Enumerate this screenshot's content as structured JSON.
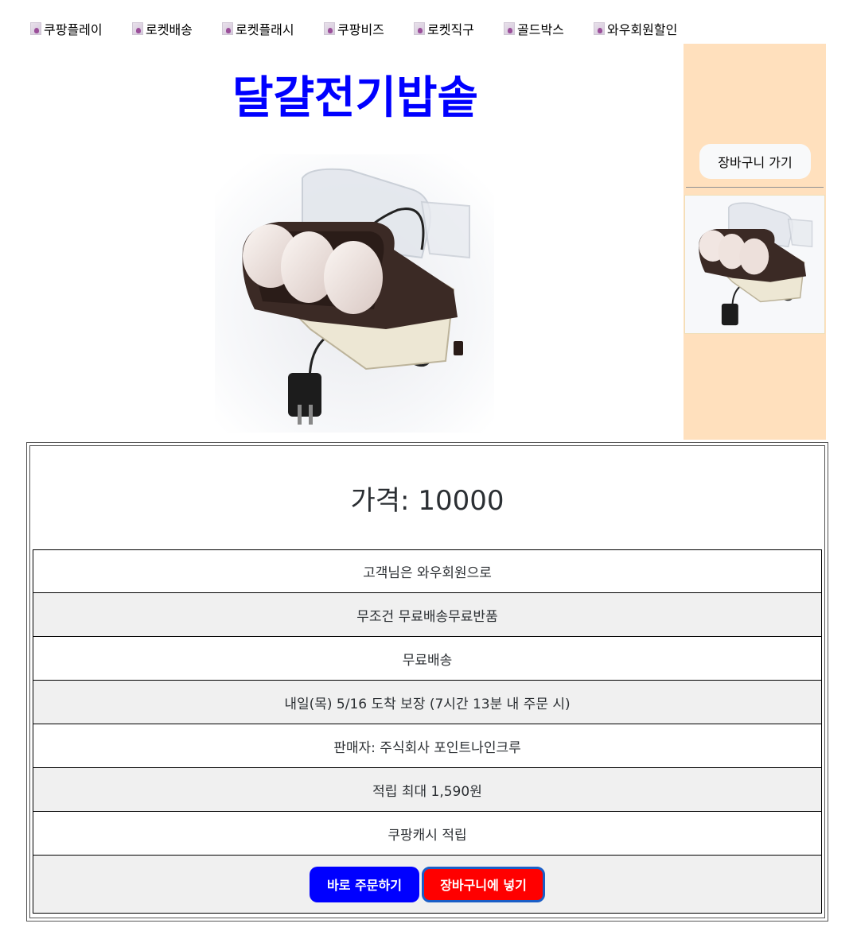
{
  "nav": {
    "items": [
      {
        "label": "쿠팡플레이",
        "icon": "broken-image-icon"
      },
      {
        "label": "로켓배송",
        "icon": "broken-image-icon"
      },
      {
        "label": "로켓플래시",
        "icon": "broken-image-icon"
      },
      {
        "label": "쿠팡비즈",
        "icon": "broken-image-icon"
      },
      {
        "label": "로켓직구",
        "icon": "broken-image-icon"
      },
      {
        "label": "골드박스",
        "icon": "broken-image-icon"
      },
      {
        "label": "와우회원할인",
        "icon": "broken-image-icon"
      }
    ]
  },
  "product": {
    "title": "달걀전기밥솥",
    "price": "가격: 10000"
  },
  "sidebar": {
    "cart_button": "장바구니 가기"
  },
  "details": [
    "고객님은 와우회원으로",
    "무조건 무료배송무료반품",
    "무료배송",
    "내일(목) 5/16 도착 보장 (7시간 13분 내 주문 시)",
    "판매자: 주식회사 포인트나인크루",
    "적립 최대 1,590원",
    "쿠팡캐시 적립"
  ],
  "actions": {
    "buy_now": "바로 주문하기",
    "add_to_cart": "장바구니에 넣기"
  },
  "colors": {
    "title": "#0000ff",
    "sidebar_bg": "#ffe0bd",
    "buy_now": "#0000ff",
    "add_to_cart": "#ff0000"
  }
}
